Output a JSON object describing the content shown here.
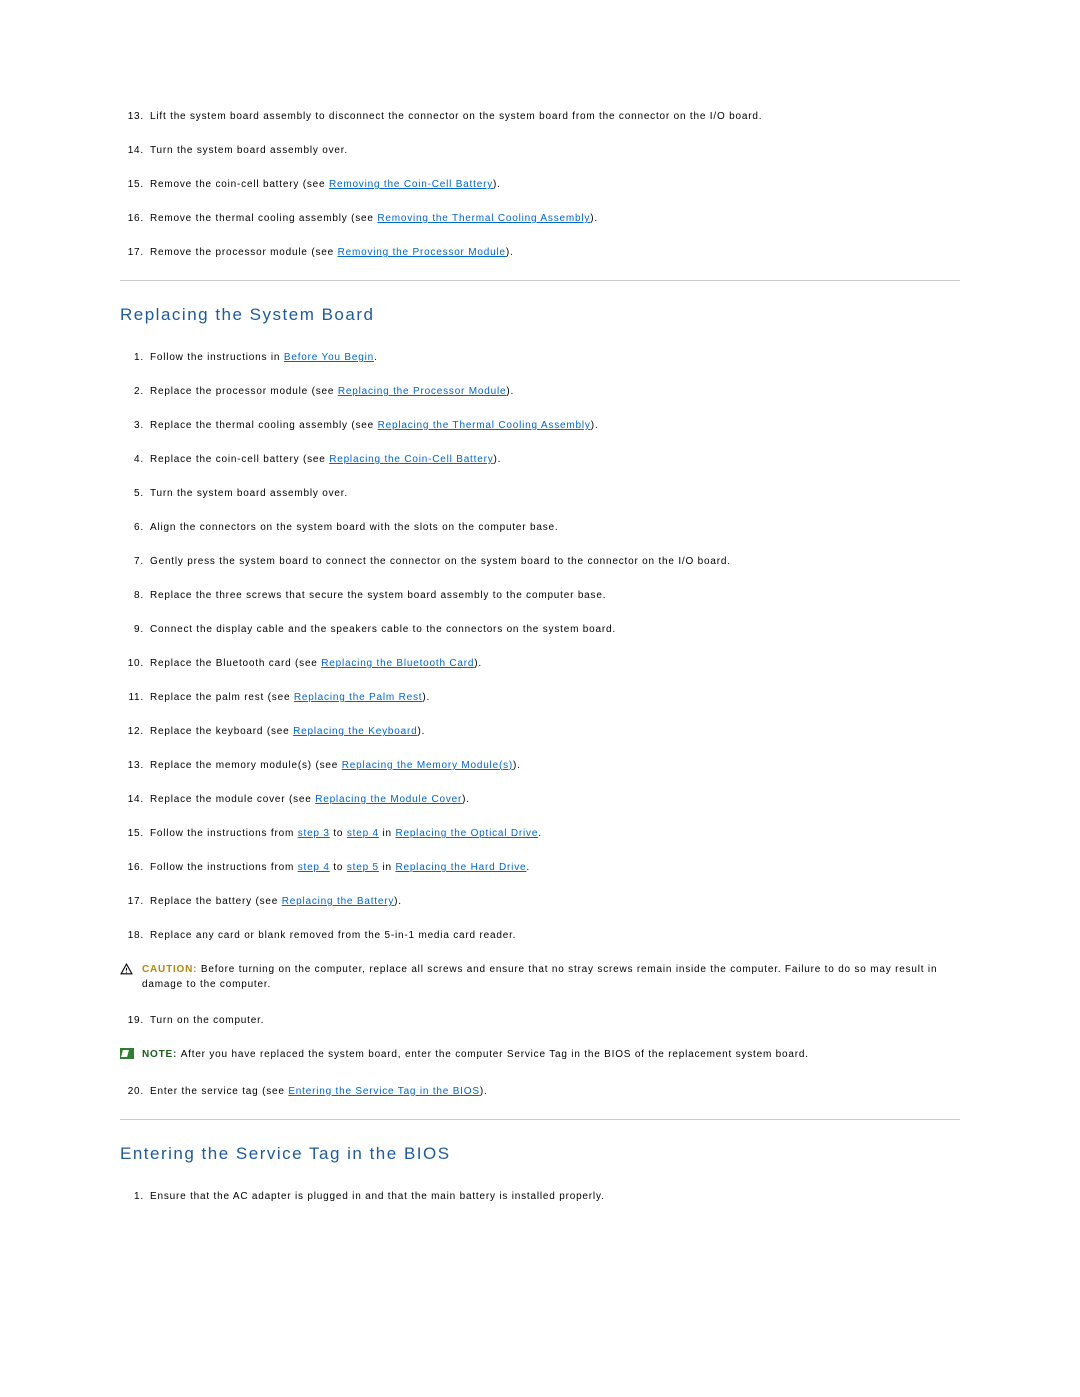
{
  "topSteps": [
    {
      "n": "13.",
      "pre": "Lift the system board assembly to disconnect the connector on the system board from the connector on the I/O board."
    },
    {
      "n": "14.",
      "pre": "Turn the system board assembly over."
    },
    {
      "n": "15.",
      "pre": "Remove the coin-cell battery (see ",
      "link": "Removing the Coin-Cell Battery",
      "post": ")."
    },
    {
      "n": "16.",
      "pre": "Remove the thermal cooling assembly (see ",
      "link": "Removing the Thermal Cooling Assembly",
      "post": ")."
    },
    {
      "n": "17.",
      "pre": "Remove the processor module (see ",
      "link": "Removing the Processor Module",
      "post": ")."
    }
  ],
  "section1": {
    "title": "Replacing the System Board",
    "steps": [
      {
        "n": "1.",
        "pre": "Follow the instructions in ",
        "link": "Before You Begin",
        "post": "."
      },
      {
        "n": "2.",
        "pre": "Replace the processor module (see ",
        "link": "Replacing the Processor Module",
        "post": ")."
      },
      {
        "n": "3.",
        "pre": "Replace the thermal cooling assembly (see ",
        "link": "Replacing the Thermal Cooling Assembly",
        "post": ")."
      },
      {
        "n": "4.",
        "pre": "Replace the coin-cell battery (see ",
        "link": "Replacing the Coin-Cell Battery",
        "post": ")."
      },
      {
        "n": "5.",
        "pre": "Turn the system board assembly over."
      },
      {
        "n": "6.",
        "pre": "Align the connectors on the system board with the slots on the computer base."
      },
      {
        "n": "7.",
        "pre": "Gently press the system board to connect the connector on the system board to the connector on the I/O board."
      },
      {
        "n": "8.",
        "pre": "Replace the three screws that secure the system board assembly to the computer base."
      },
      {
        "n": "9.",
        "pre": "Connect the display cable and the speakers cable to the connectors on the system board."
      },
      {
        "n": "10.",
        "pre": "Replace the Bluetooth card (see ",
        "link": "Replacing the Bluetooth Card",
        "post": ")."
      },
      {
        "n": "11.",
        "pre": "Replace the palm rest (see ",
        "link": "Replacing the Palm Rest",
        "post": ")."
      },
      {
        "n": "12.",
        "pre": "Replace the keyboard (see ",
        "link": "Replacing the Keyboard",
        "post": ")."
      },
      {
        "n": "13.",
        "pre": "Replace the memory module(s) (see ",
        "link": "Replacing the Memory Module(s)",
        "post": ")."
      },
      {
        "n": "14.",
        "pre": "Replace the module cover (see ",
        "link": "Replacing the Module Cover",
        "post": ")."
      },
      {
        "n": "15.",
        "parts": [
          {
            "t": "Follow the instructions from "
          },
          {
            "l": "step 3"
          },
          {
            "t": " to "
          },
          {
            "l": "step 4"
          },
          {
            "t": " in "
          },
          {
            "l": "Replacing the Optical Drive"
          },
          {
            "t": "."
          }
        ]
      },
      {
        "n": "16.",
        "parts": [
          {
            "t": "Follow the instructions from "
          },
          {
            "l": "step 4"
          },
          {
            "t": " to "
          },
          {
            "l": "step 5"
          },
          {
            "t": " in "
          },
          {
            "l": "Replacing the Hard Drive"
          },
          {
            "t": "."
          }
        ]
      },
      {
        "n": "17.",
        "pre": "Replace the battery (see ",
        "link": "Replacing the Battery",
        "post": ")."
      },
      {
        "n": "18.",
        "pre": "Replace any card or blank removed from the 5-in-1 media card reader."
      }
    ],
    "caution": {
      "label": "CAUTION: ",
      "text": "Before turning on the computer, replace all screws and ensure that no stray screws remain inside the computer. Failure to do so may result in damage to the computer."
    },
    "step19": {
      "n": "19.",
      "pre": "Turn on the computer."
    },
    "note": {
      "label": "NOTE: ",
      "text": "After you have replaced the system board, enter the computer Service Tag in the BIOS of the replacement system board."
    },
    "step20": {
      "n": "20.",
      "pre": "Enter the service tag (see ",
      "link": "Entering the Service Tag in the BIOS",
      "post": ")."
    }
  },
  "section2": {
    "title": "Entering the Service Tag in the BIOS",
    "steps": [
      {
        "n": "1.",
        "pre": "Ensure that the AC adapter is plugged in and that the main battery is installed properly."
      }
    ]
  }
}
